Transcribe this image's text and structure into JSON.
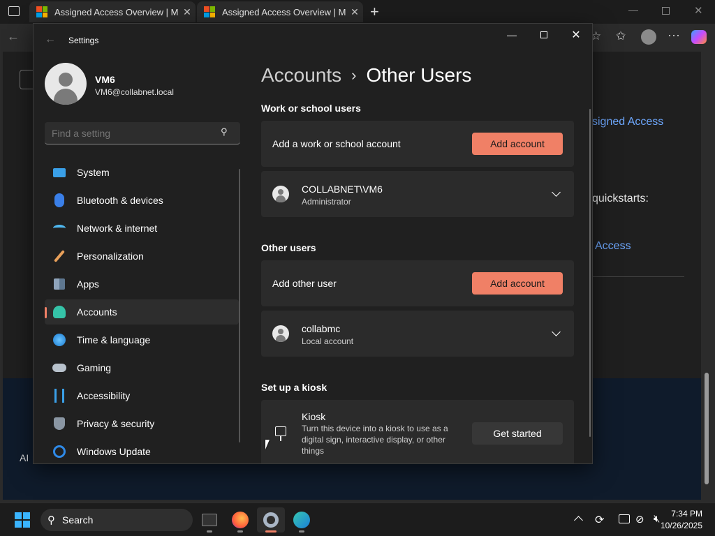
{
  "browser": {
    "tabs": [
      {
        "title": "Assigned Access Overview | Micro"
      },
      {
        "title": "Assigned Access Overview | Micro"
      }
    ],
    "background_links": [
      "signed Access",
      "quickstarts:",
      "Access"
    ],
    "background_footer": "AI"
  },
  "settings": {
    "app_title": "Settings",
    "user": {
      "name": "VM6",
      "email": "VM6@collabnet.local"
    },
    "search": {
      "placeholder": "Find a setting"
    },
    "nav": [
      {
        "label": "System",
        "icon": "monitor-icon"
      },
      {
        "label": "Bluetooth & devices",
        "icon": "bluetooth-icon"
      },
      {
        "label": "Network & internet",
        "icon": "wifi-icon"
      },
      {
        "label": "Personalization",
        "icon": "brush-icon"
      },
      {
        "label": "Apps",
        "icon": "apps-icon"
      },
      {
        "label": "Accounts",
        "icon": "person-icon",
        "selected": true
      },
      {
        "label": "Time & language",
        "icon": "globe-clock-icon"
      },
      {
        "label": "Gaming",
        "icon": "gamepad-icon"
      },
      {
        "label": "Accessibility",
        "icon": "accessibility-icon"
      },
      {
        "label": "Privacy & security",
        "icon": "shield-icon"
      },
      {
        "label": "Windows Update",
        "icon": "update-icon"
      }
    ],
    "breadcrumb": {
      "parent": "Accounts",
      "separator": "›",
      "current": "Other Users"
    },
    "work_section": {
      "heading": "Work or school users",
      "add_label": "Add a work or school account",
      "add_button": "Add account",
      "account": {
        "name": "COLLABNET\\VM6",
        "type": "Administrator"
      }
    },
    "other_section": {
      "heading": "Other users",
      "add_label": "Add other user",
      "add_button": "Add account",
      "account": {
        "name": "collabmc",
        "type": "Local account"
      }
    },
    "kiosk_section": {
      "heading": "Set up a kiosk",
      "title": "Kiosk",
      "description": "Turn this device into a kiosk to use as a digital sign, interactive display, or other things",
      "button": "Get started"
    }
  },
  "taskbar": {
    "search_label": "Search",
    "clock": {
      "time": "7:34 PM",
      "date": "10/26/2025"
    }
  },
  "colors": {
    "accent": "#f08066",
    "link": "#6ea8ff",
    "window_bg": "#202020",
    "card_bg": "#2b2b2b"
  }
}
